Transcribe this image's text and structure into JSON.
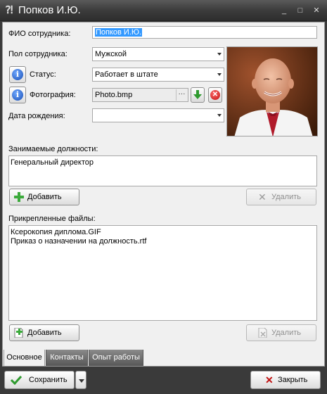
{
  "window": {
    "title": "Попков И.Ю.",
    "minimize_glyph": "_",
    "maximize_glyph": "□",
    "close_glyph": "✕"
  },
  "form": {
    "fio_label": "ФИО сотрудника:",
    "fio_value": "Попков И.Ю.",
    "gender_label": "Пол сотрудника:",
    "gender_value": "Мужской",
    "status_label": "Статус:",
    "status_value": "Работает в штате",
    "photo_label": "Фотография:",
    "photo_value": "Photo.bmp",
    "photo_browse": "···",
    "birth_label": "Дата рождения:",
    "birth_value": ""
  },
  "positions": {
    "label": "Занимаемые должности:",
    "items": [
      "Генеральный директор"
    ],
    "add_label": "Добавить",
    "delete_label": "Удалить"
  },
  "files": {
    "label": "Прикрепленные файлы:",
    "items": [
      "Ксерокопия диплома.GIF",
      "Приказ о назначении на должность.rtf"
    ],
    "add_label": "Добавить",
    "delete_label": "Удалить"
  },
  "tabs": [
    {
      "label": "Основное",
      "active": true
    },
    {
      "label": "Контакты",
      "active": false
    },
    {
      "label": "Опыт работы",
      "active": false
    }
  ],
  "footer": {
    "save_label": "Сохранить",
    "close_label": "Закрыть"
  },
  "colors": {
    "selection": "#3399ff",
    "frame": "#3a3a3a",
    "save_check": "#2e9a2e",
    "close_x": "#c01010",
    "add_plus": "#3caa3c"
  }
}
